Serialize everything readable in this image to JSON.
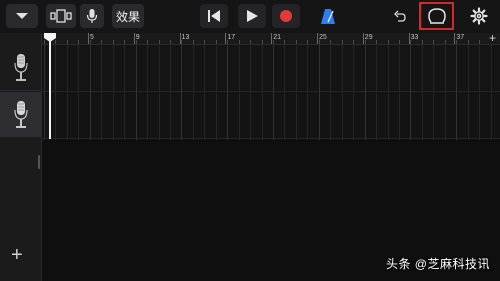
{
  "toolbar": {
    "effects_label": "效果",
    "accent_record": "#e23a3a",
    "accent_metronome": "#2f7df2",
    "highlight_color": "#d6282a"
  },
  "ruler": {
    "labels": [
      "5",
      "9",
      "13",
      "17",
      "21",
      "25",
      "29",
      "33",
      "37"
    ],
    "add_label": "+"
  },
  "track_panel": {
    "add_label": "+"
  },
  "watermark": "头条 @芝麻科技讯"
}
